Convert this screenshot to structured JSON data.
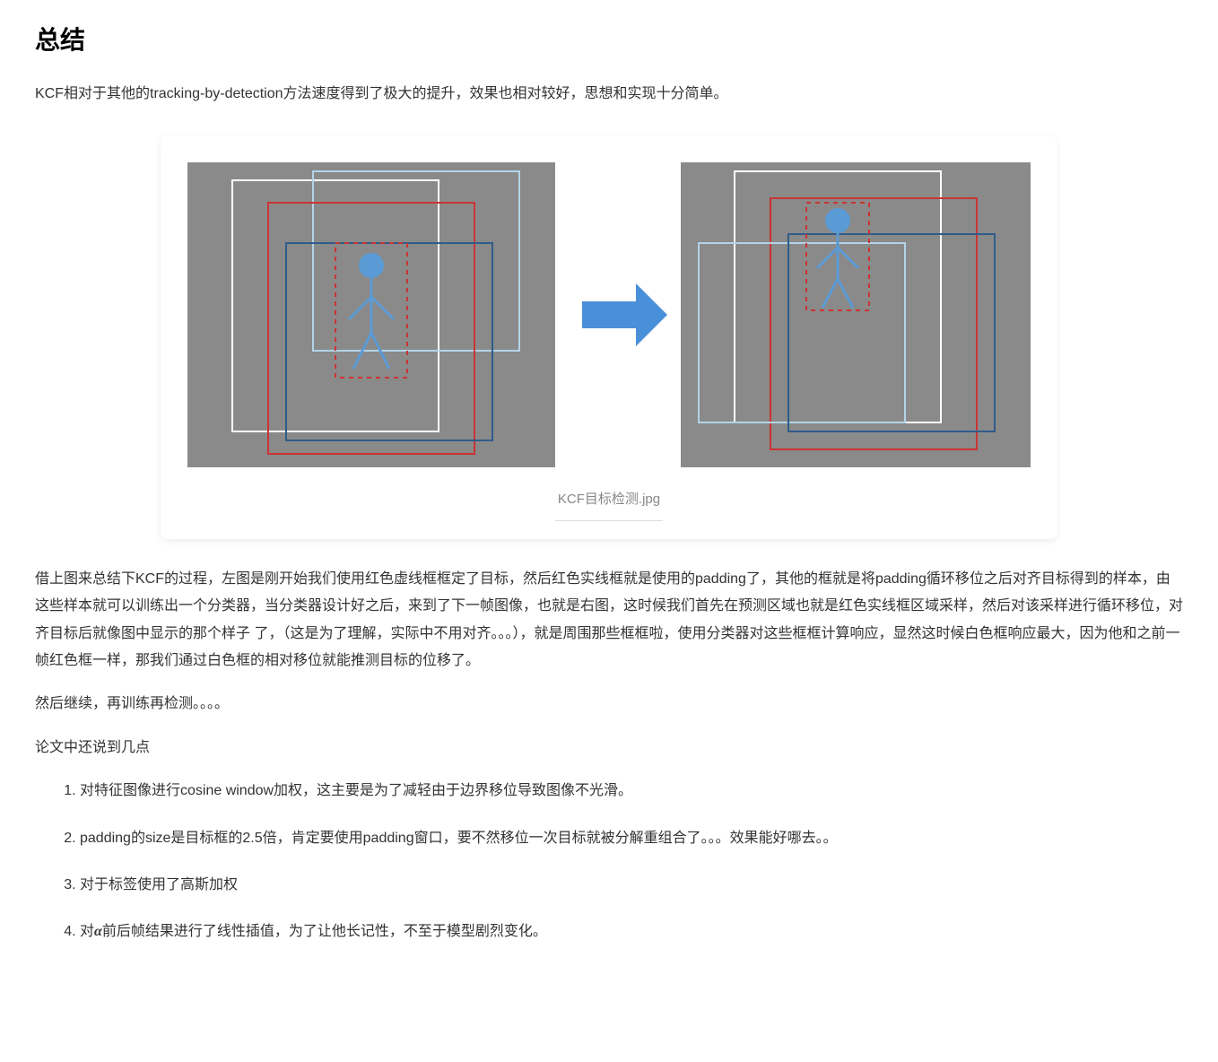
{
  "heading": "总结",
  "intro": "KCF相对于其他的tracking-by-detection方法速度得到了极大的提升，效果也相对较好，思想和实现十分简单。",
  "figure_caption": "KCF目标检测.jpg",
  "para1": "借上图来总结下KCF的过程，左图是刚开始我们使用红色虚线框框定了目标，然后红色实线框就是使用的padding了，其他的框就是将padding循环移位之后对齐目标得到的样本，由这些样本就可以训练出一个分类器，当分类器设计好之后，来到了下一帧图像，也就是右图，这时候我们首先在预测区域也就是红色实线框区域采样，然后对该采样进行循环移位，对齐目标后就像图中显示的那个样子 了，（这是为了理解，实际中不用对齐。。。），就是周围那些框框啦，使用分类器对这些框框计算响应，显然这时候白色框响应最大，因为他和之前一帧红色框一样，那我们通过白色框的相对移位就能推测目标的位移了。",
  "para2": "然后继续，再训练再检测。。。。",
  "para3": "论文中还说到几点",
  "list": {
    "item1": "对特征图像进行cosine window加权，这主要是为了减轻由于边界移位导致图像不光滑。",
    "item2": "padding的size是目标框的2.5倍，肯定要使用padding窗口，要不然移位一次目标就被分解重组合了。。。效果能好哪去。。",
    "item3": "对于标签使用了高斯加权",
    "item4_prefix": "对",
    "item4_symbol": "α",
    "item4_suffix": "前后帧结果进行了线性插值，为了让他长记性，不至于模型剧烈变化。"
  }
}
